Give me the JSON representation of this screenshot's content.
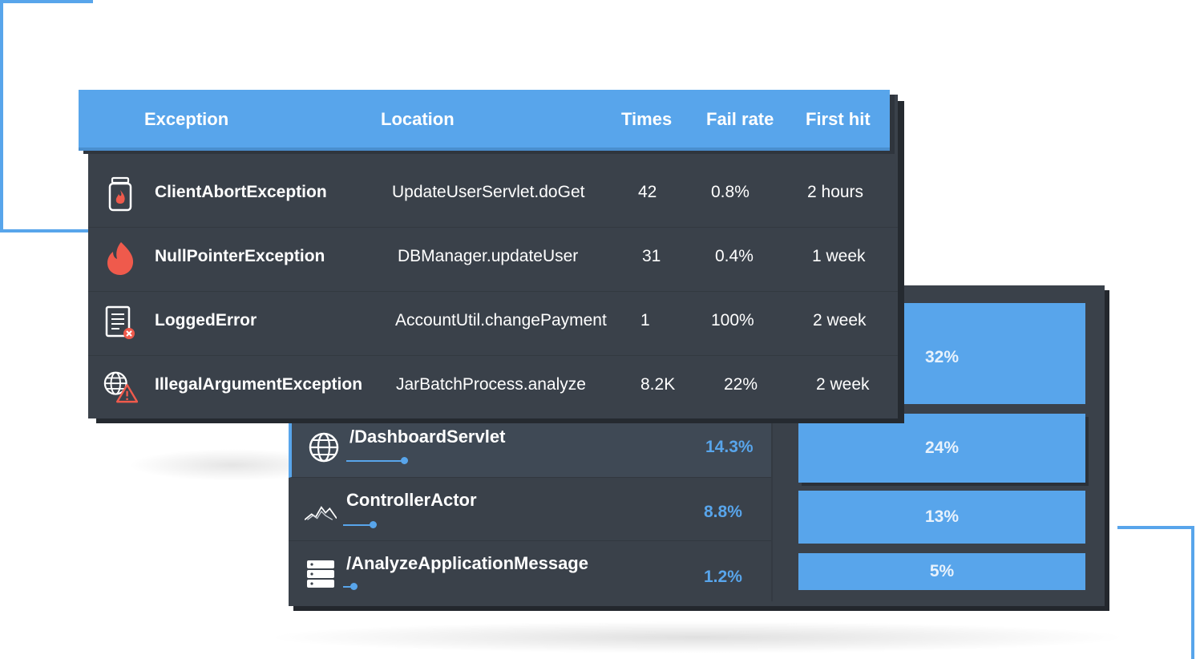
{
  "colors": {
    "accent": "#58a5eb",
    "panel": "#3a414a",
    "error": "#ef5a4c"
  },
  "exceptions_table": {
    "headers": [
      "Exception",
      "Location",
      "Times",
      "Fail rate",
      "First hit"
    ],
    "rows": [
      {
        "icon": "jar-fire-icon",
        "exception": "ClientAbortException",
        "location": "UpdateUserServlet.doGet",
        "times": "42",
        "fail_rate": "0.8%",
        "first_hit": "2 hours"
      },
      {
        "icon": "flame-icon",
        "exception": "NullPointerException",
        "location": "DBManager.updateUser",
        "times": "31",
        "fail_rate": "0.4%",
        "first_hit": "1 week"
      },
      {
        "icon": "error-log-icon",
        "exception": "LoggedError",
        "location": "AccountUtil.changePayment",
        "times": "1",
        "fail_rate": "100%",
        "first_hit": "2 week"
      },
      {
        "icon": "globe-warning-icon",
        "exception": "IllegalArgumentException",
        "location": "JarBatchProcess.analyze",
        "times": "8.2K",
        "fail_rate": "22%",
        "first_hit": "2 week"
      }
    ]
  },
  "transactions": [
    {
      "icon": "globe-icon",
      "name": "/DashboardServlet",
      "percent": "14.3%",
      "active": true
    },
    {
      "icon": "mountain-chart-icon",
      "name": "ControllerActor",
      "percent": "8.8%",
      "active": false
    },
    {
      "icon": "server-stack-icon",
      "name": "/AnalyzeApplicationMessage",
      "percent": "1.2%",
      "active": false
    }
  ],
  "bars": [
    {
      "label": "32%"
    },
    {
      "label": "24%"
    },
    {
      "label": "13%"
    },
    {
      "label": "5%"
    }
  ]
}
